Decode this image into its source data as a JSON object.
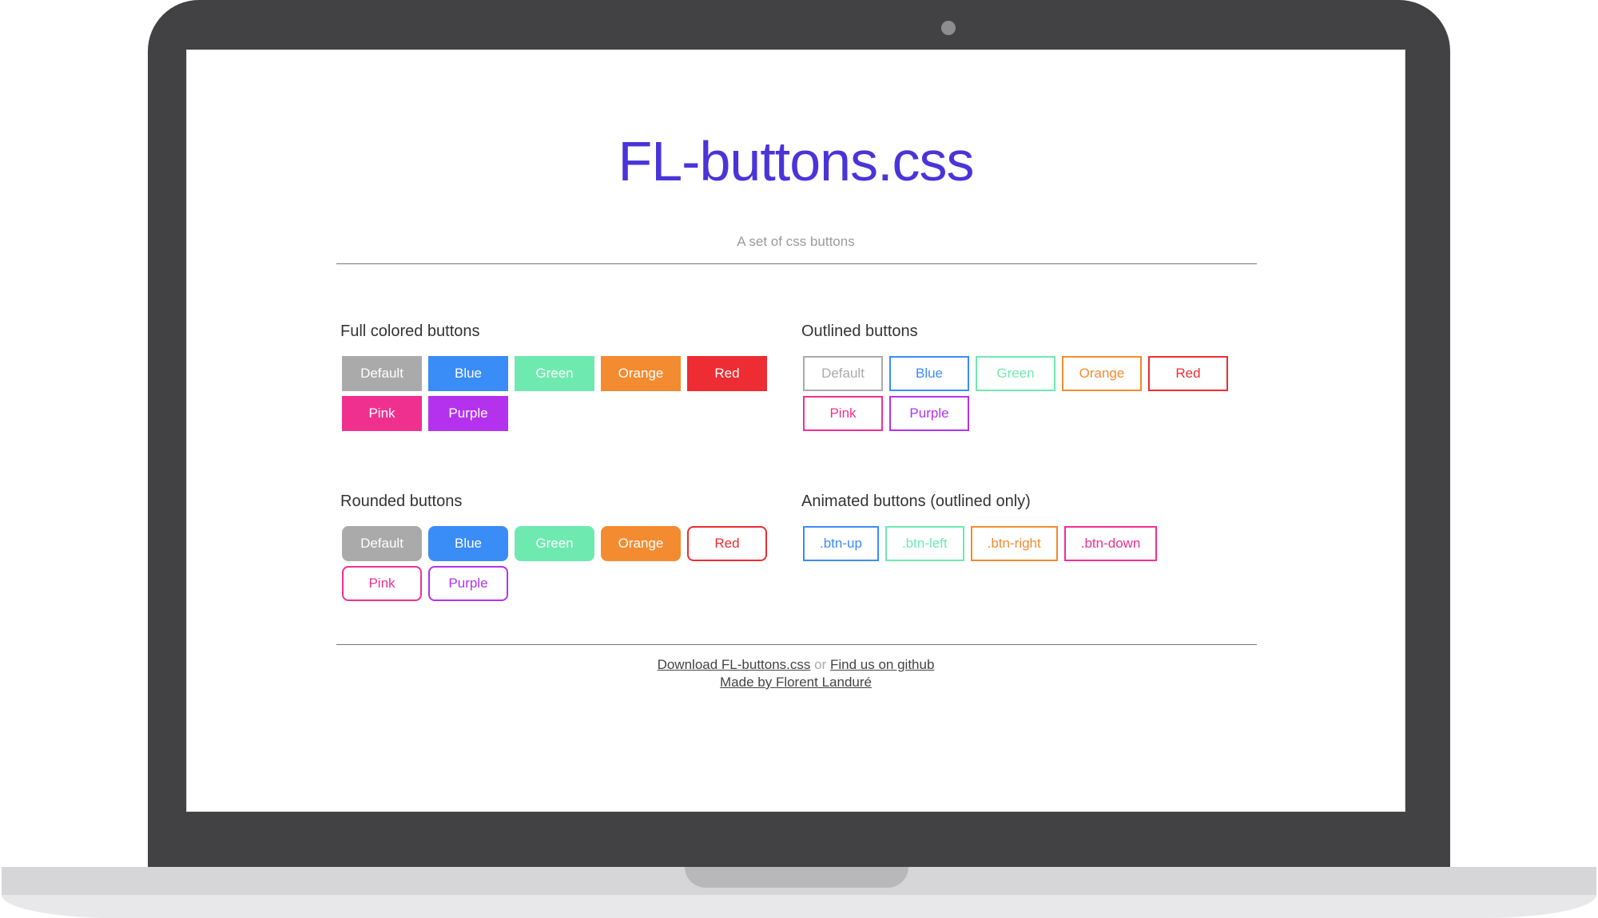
{
  "page": {
    "title": "FL-buttons.css",
    "subtitle": "A set of css buttons"
  },
  "colors": {
    "title": "#4a34d8",
    "default": "#aaaaaa",
    "blue": "#3a8cf7",
    "green": "#6eeab0",
    "orange": "#f38b30",
    "red": "#ee2c33",
    "pink": "#f0308f",
    "purple": "#b432ee"
  },
  "sections": {
    "full": {
      "title": "Full colored buttons",
      "buttons": [
        {
          "label": "Default",
          "color": "#aaaaaa"
        },
        {
          "label": "Blue",
          "color": "#3a8cf7"
        },
        {
          "label": "Green",
          "color": "#6eeab0"
        },
        {
          "label": "Orange",
          "color": "#f38b30"
        },
        {
          "label": "Red",
          "color": "#ee2c33"
        },
        {
          "label": "Pink",
          "color": "#f0308f"
        },
        {
          "label": "Purple",
          "color": "#b432ee"
        }
      ]
    },
    "outlined": {
      "title": "Outlined buttons",
      "buttons": [
        {
          "label": "Default",
          "color": "#aaaaaa"
        },
        {
          "label": "Blue",
          "color": "#3a8cf7"
        },
        {
          "label": "Green",
          "color": "#6eeab0"
        },
        {
          "label": "Orange",
          "color": "#f38b30"
        },
        {
          "label": "Red",
          "color": "#ee2c33"
        },
        {
          "label": "Pink",
          "color": "#f0308f"
        },
        {
          "label": "Purple",
          "color": "#b432ee"
        }
      ]
    },
    "rounded": {
      "title": "Rounded buttons",
      "buttons": [
        {
          "label": "Default",
          "color": "#aaaaaa",
          "style": "fill"
        },
        {
          "label": "Blue",
          "color": "#3a8cf7",
          "style": "fill"
        },
        {
          "label": "Green",
          "color": "#6eeab0",
          "style": "fill"
        },
        {
          "label": "Orange",
          "color": "#f38b30",
          "style": "fill"
        },
        {
          "label": "Red",
          "color": "#ee2c33",
          "style": "outline"
        },
        {
          "label": "Pink",
          "color": "#f0308f",
          "style": "outline"
        },
        {
          "label": "Purple",
          "color": "#b432ee",
          "style": "outline"
        }
      ]
    },
    "animated": {
      "title": "Animated buttons (outlined only)",
      "buttons": [
        {
          "label": ".btn-up",
          "color": "#3a8cf7"
        },
        {
          "label": ".btn-left",
          "color": "#6eeab0"
        },
        {
          "label": ".btn-right",
          "color": "#f38b30"
        },
        {
          "label": ".btn-down",
          "color": "#f0308f"
        }
      ]
    }
  },
  "footer": {
    "download_link": "Download FL-buttons.css",
    "separator": "or",
    "github_link": "Find us on github",
    "author_link": "Made by Florent Landuré"
  }
}
